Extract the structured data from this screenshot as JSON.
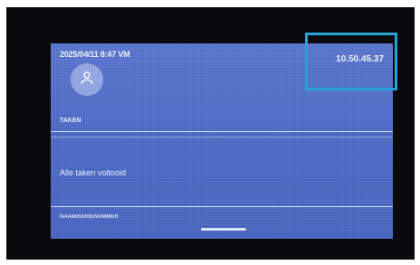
{
  "status_bar": {
    "datetime": "2025/04/11 8:47 VM",
    "clock": "10.50.45.37"
  },
  "user": {
    "avatar_icon": "person-icon",
    "section_label": "TAKEN"
  },
  "tasks": {
    "message": "Alle taken voltooid"
  },
  "footer": {
    "text": "NAAM/SERIENUMMER"
  },
  "colors": {
    "screen_background": "#4f6cc8",
    "highlight": "#27a2d9",
    "bezel": "#0a0a0c"
  }
}
